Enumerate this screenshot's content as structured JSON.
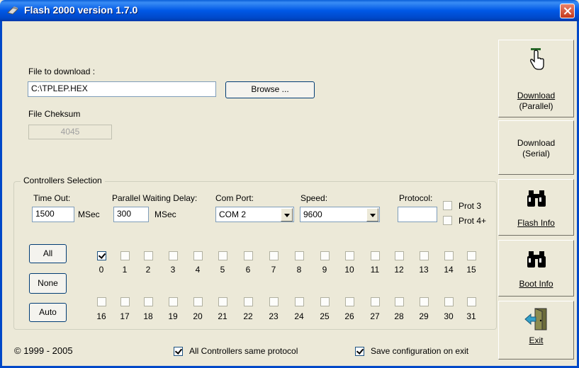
{
  "window": {
    "title": "Flash 2000 version 1.7.0"
  },
  "file": {
    "label": "File to download :",
    "value": "C:\\TPLEP.HEX",
    "browse_label": "Browse ...",
    "checksum_label": "File Cheksum",
    "checksum_value": "4045"
  },
  "controllers": {
    "group_label": "Controllers Selection",
    "timeout_label": "Time Out:",
    "timeout_value": "1500",
    "timeout_unit": "MSec",
    "parallel_label": "Parallel Waiting Delay:",
    "parallel_value": "300",
    "parallel_unit": "MSec",
    "com_label": "Com Port:",
    "com_value": "COM 2",
    "speed_label": "Speed:",
    "speed_value": "9600",
    "protocol_label": "Protocol:",
    "protocol_value": "",
    "prot3_label": "Prot 3",
    "prot4_label": "Prot 4+",
    "all_label": "All",
    "none_label": "None",
    "auto_label": "Auto",
    "row1": [
      {
        "n": "0",
        "checked": true
      },
      {
        "n": "1",
        "checked": false
      },
      {
        "n": "2",
        "checked": false
      },
      {
        "n": "3",
        "checked": false
      },
      {
        "n": "4",
        "checked": false
      },
      {
        "n": "5",
        "checked": false
      },
      {
        "n": "6",
        "checked": false
      },
      {
        "n": "7",
        "checked": false
      },
      {
        "n": "8",
        "checked": false
      },
      {
        "n": "9",
        "checked": false
      },
      {
        "n": "10",
        "checked": false
      },
      {
        "n": "11",
        "checked": false
      },
      {
        "n": "12",
        "checked": false
      },
      {
        "n": "13",
        "checked": false
      },
      {
        "n": "14",
        "checked": false
      },
      {
        "n": "15",
        "checked": false
      }
    ],
    "row2": [
      {
        "n": "16",
        "checked": false
      },
      {
        "n": "17",
        "checked": false
      },
      {
        "n": "18",
        "checked": false
      },
      {
        "n": "19",
        "checked": false
      },
      {
        "n": "20",
        "checked": false
      },
      {
        "n": "21",
        "checked": false
      },
      {
        "n": "22",
        "checked": false
      },
      {
        "n": "23",
        "checked": false
      },
      {
        "n": "24",
        "checked": false
      },
      {
        "n": "25",
        "checked": false
      },
      {
        "n": "26",
        "checked": false
      },
      {
        "n": "27",
        "checked": false
      },
      {
        "n": "28",
        "checked": false
      },
      {
        "n": "29",
        "checked": false
      },
      {
        "n": "30",
        "checked": false
      },
      {
        "n": "31",
        "checked": false
      }
    ]
  },
  "footer": {
    "copyright": "© 1999 - 2005",
    "same_protocol_label": "All Controllers same protocol",
    "same_protocol_checked": true,
    "save_config_label": "Save configuration on exit",
    "save_config_checked": true
  },
  "side_buttons": {
    "download_parallel_line1": "Download",
    "download_parallel_line2": "(Parallel)",
    "download_serial_line1": "Download",
    "download_serial_line2": "(Serial)",
    "flash_info": "Flash Info",
    "boot_info": "Boot Info",
    "exit": "Exit"
  }
}
